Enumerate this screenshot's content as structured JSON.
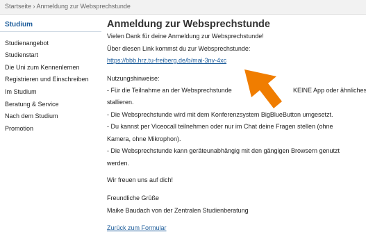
{
  "breadcrumb": "Startseite › Anmeldung zur Websprechstunde",
  "sidebar": {
    "title": "Studium",
    "items": [
      {
        "label": "Studienangebot"
      },
      {
        "label": "Studienstart"
      },
      {
        "label": "Die Uni zum Kennenlernen"
      },
      {
        "label": "Registrieren und Einschreiben"
      },
      {
        "label": "Im Studium"
      },
      {
        "label": "Beratung & Service"
      },
      {
        "label": "Nach dem Studium"
      },
      {
        "label": "Promotion"
      }
    ]
  },
  "main": {
    "title": "Anmeldung zur Websprechstunde",
    "thanks": "Vielen Dank für deine Anmeldung zur Websprechstunde!",
    "link_intro": "Über diesen Link kommst du zur Websprechstunde:",
    "meeting_link": "https://bbb.hrz.tu-freiberg.de/b/mai-3nv-4xc",
    "usage_heading": "Nutzungshinweise:",
    "usage_lines": [
      "- Für die Teilnahme an der Websprechstunde",
      "KEINE App oder ähnliches in-",
      "stallieren.",
      "- Die Websprechstunde wird mit dem Konferenzsystem BigBlueButton umgesetzt.",
      "- Du kannst per Viceocall teilnehmen oder nur im Chat deine Fragen stellen (ohne",
      "Kamera, ohne Mikrophon).",
      "- Die Websprechstunde kann geräteunabhängig mit den gängigen Browsern genutzt",
      "werden."
    ],
    "closing": "Wir freuen uns auf dich!",
    "greeting": "Freundliche Grüße",
    "signature": "Maike Baudach von der Zentralen Studienberatung",
    "back_link": "Zurück zum Formular"
  },
  "colors": {
    "accent": "#1e5d9b",
    "arrow": "#f07d00",
    "breadcrumb_bg": "#f2f2f2"
  },
  "annotation_icon": "arrow-pointer-icon"
}
